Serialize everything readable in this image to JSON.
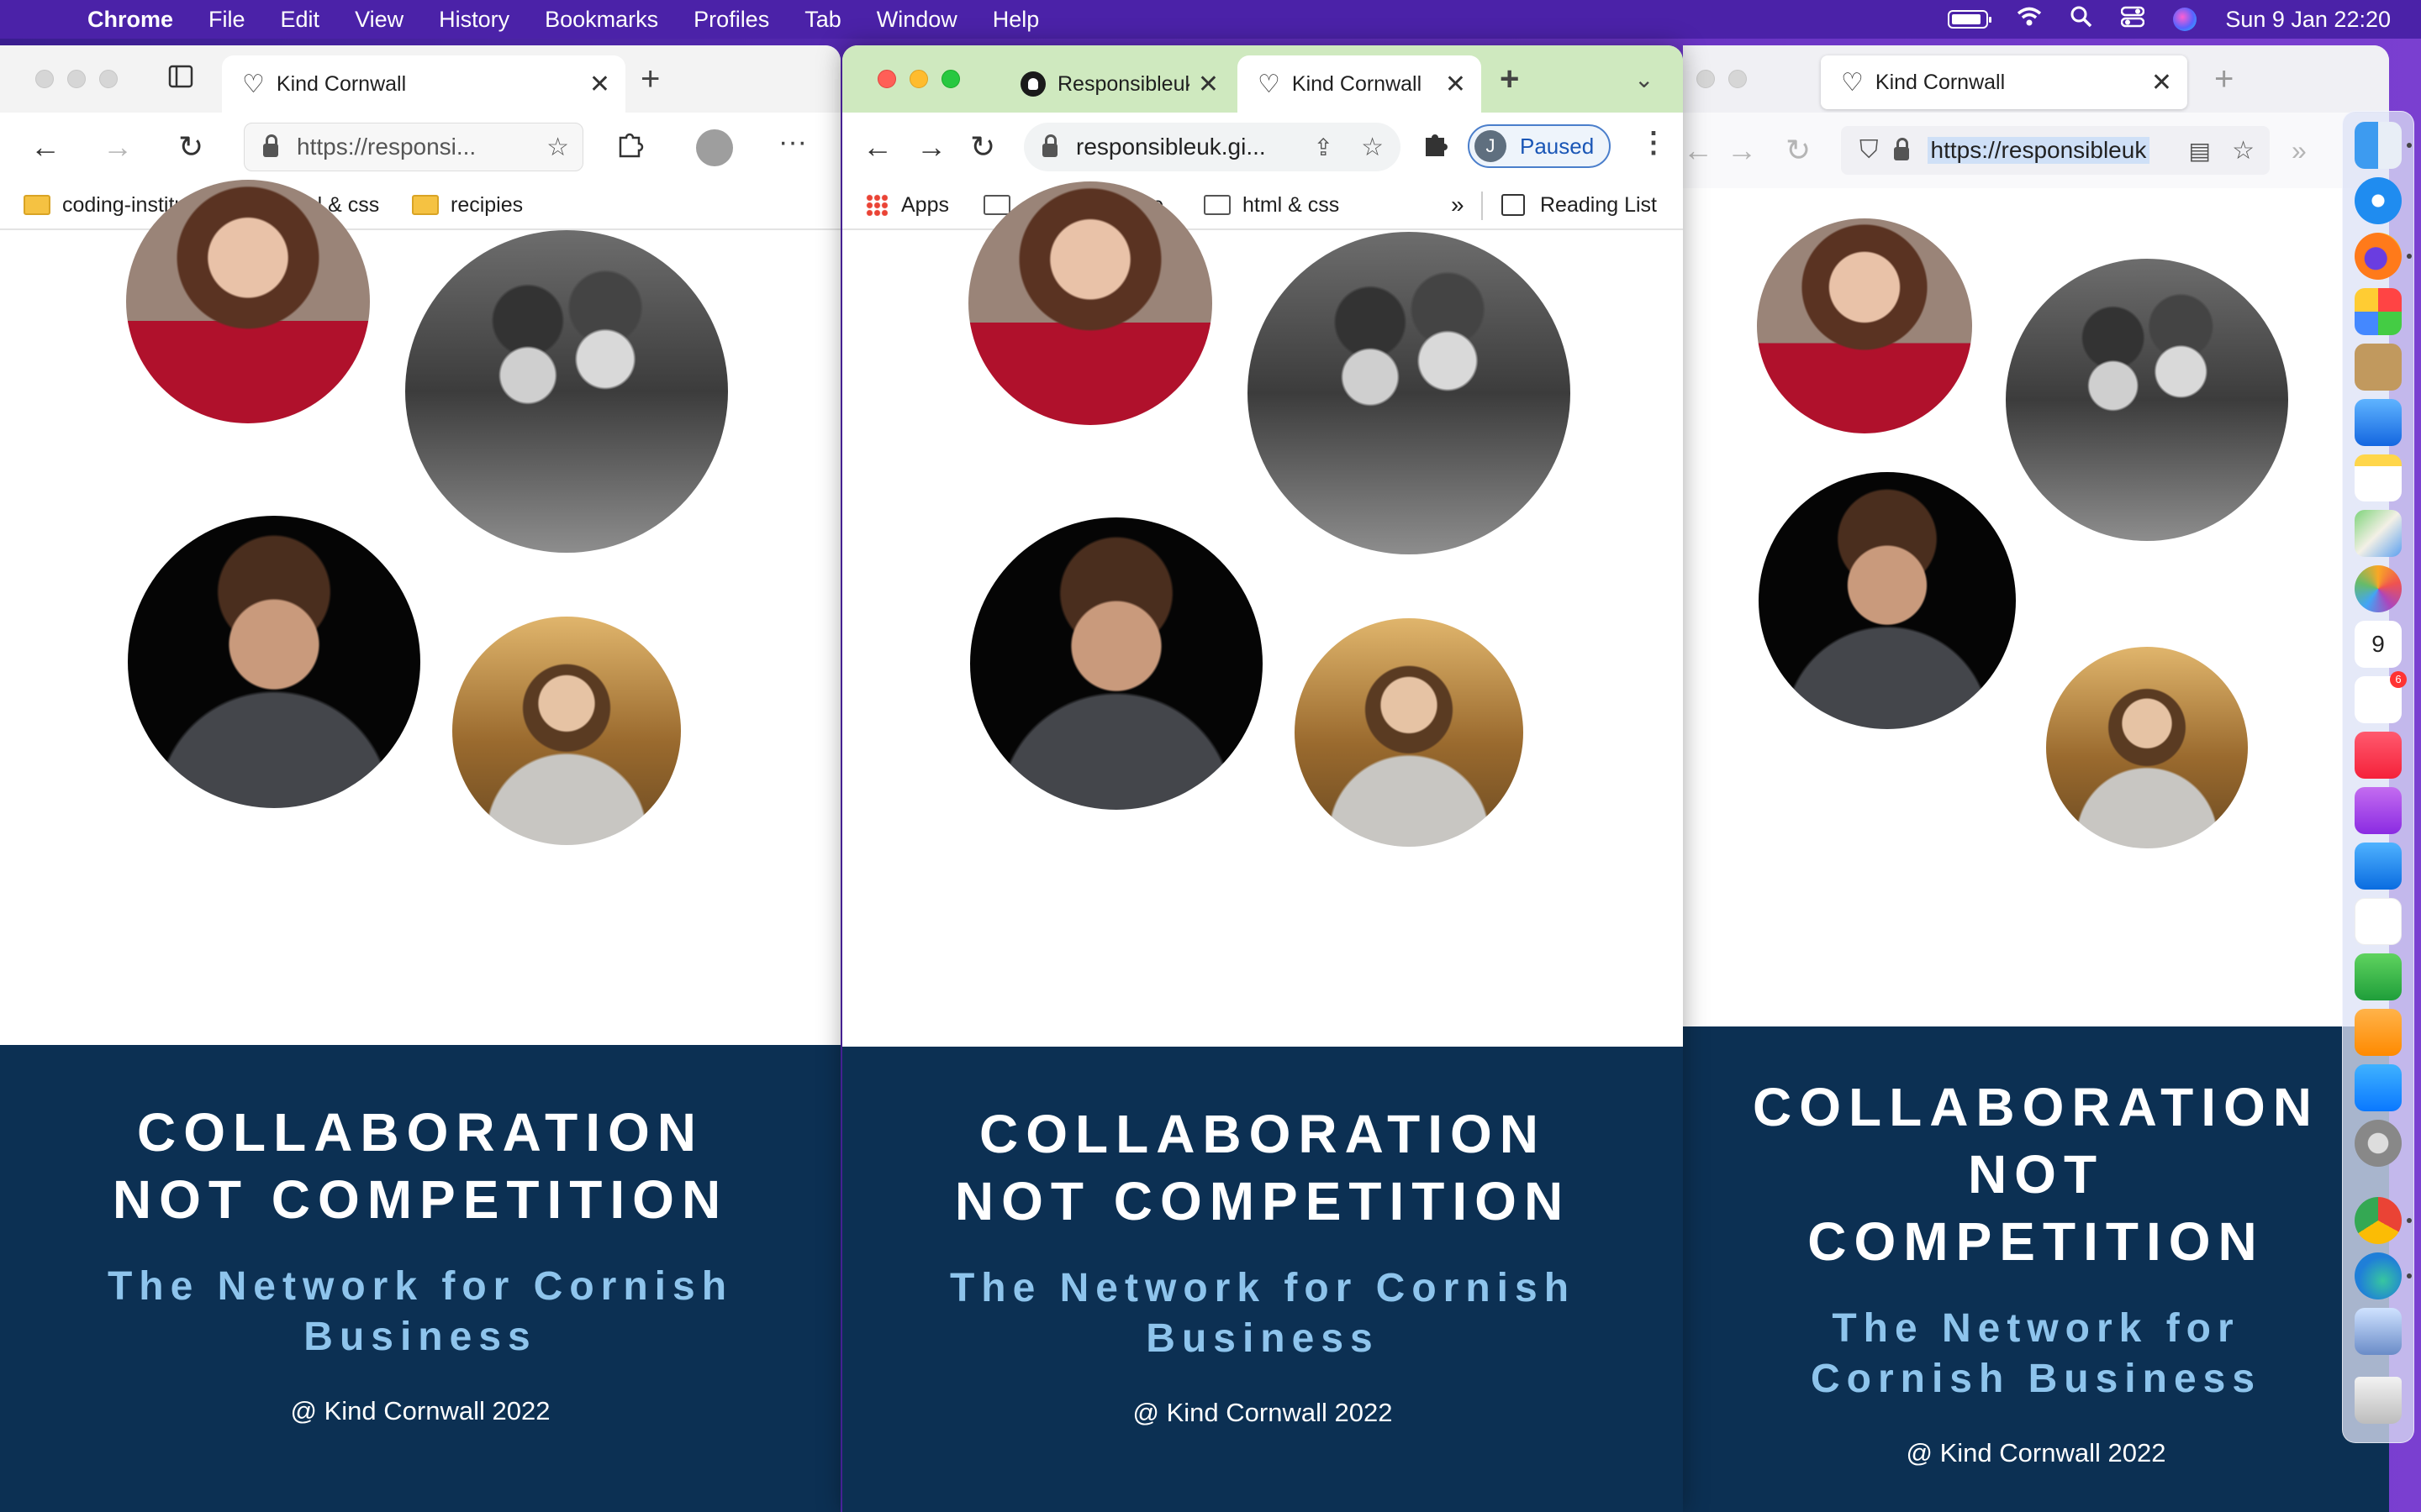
{
  "menubar": {
    "app_name": "Chrome",
    "items": [
      "File",
      "Edit",
      "View",
      "History",
      "Bookmarks",
      "Profiles",
      "Tab",
      "Window",
      "Help"
    ],
    "datetime": "Sun 9 Jan  22:20"
  },
  "edge": {
    "tab_title": "Kind Cornwall",
    "url": "https://responsi...",
    "bookmarks": [
      "coding-institute",
      "html & css",
      "recipies"
    ]
  },
  "chrome": {
    "tabs": [
      {
        "title": "Responsibleuk"
      },
      {
        "title": "Kind Cornwall"
      }
    ],
    "url": "responsibleuk.gi...",
    "profile_initial": "J",
    "profile_status": "Paused",
    "bookmarks": [
      "Apps",
      "coding-institute",
      "html & css"
    ],
    "more": "»",
    "reading_list": "Reading List"
  },
  "firefox": {
    "tab_title": "Kind Cornwall",
    "url": "https://responsibleuk"
  },
  "site": {
    "headline_line1": "COLLABORATION",
    "headline_line2": "NOT COMPETITION",
    "headline_narrow_1": "COLLABORATION",
    "headline_narrow_2": "NOT",
    "headline_narrow_3": "COMPETITION",
    "tagline_line1": "The Network for Cornish",
    "tagline_line2": "Business",
    "tagline_narrow_1": "The Network for",
    "tagline_narrow_2": "Cornish Business",
    "copyright": "@ Kind Cornwall 2022"
  },
  "dock": {
    "calendar_day": "9",
    "reminders_badge": "6"
  }
}
